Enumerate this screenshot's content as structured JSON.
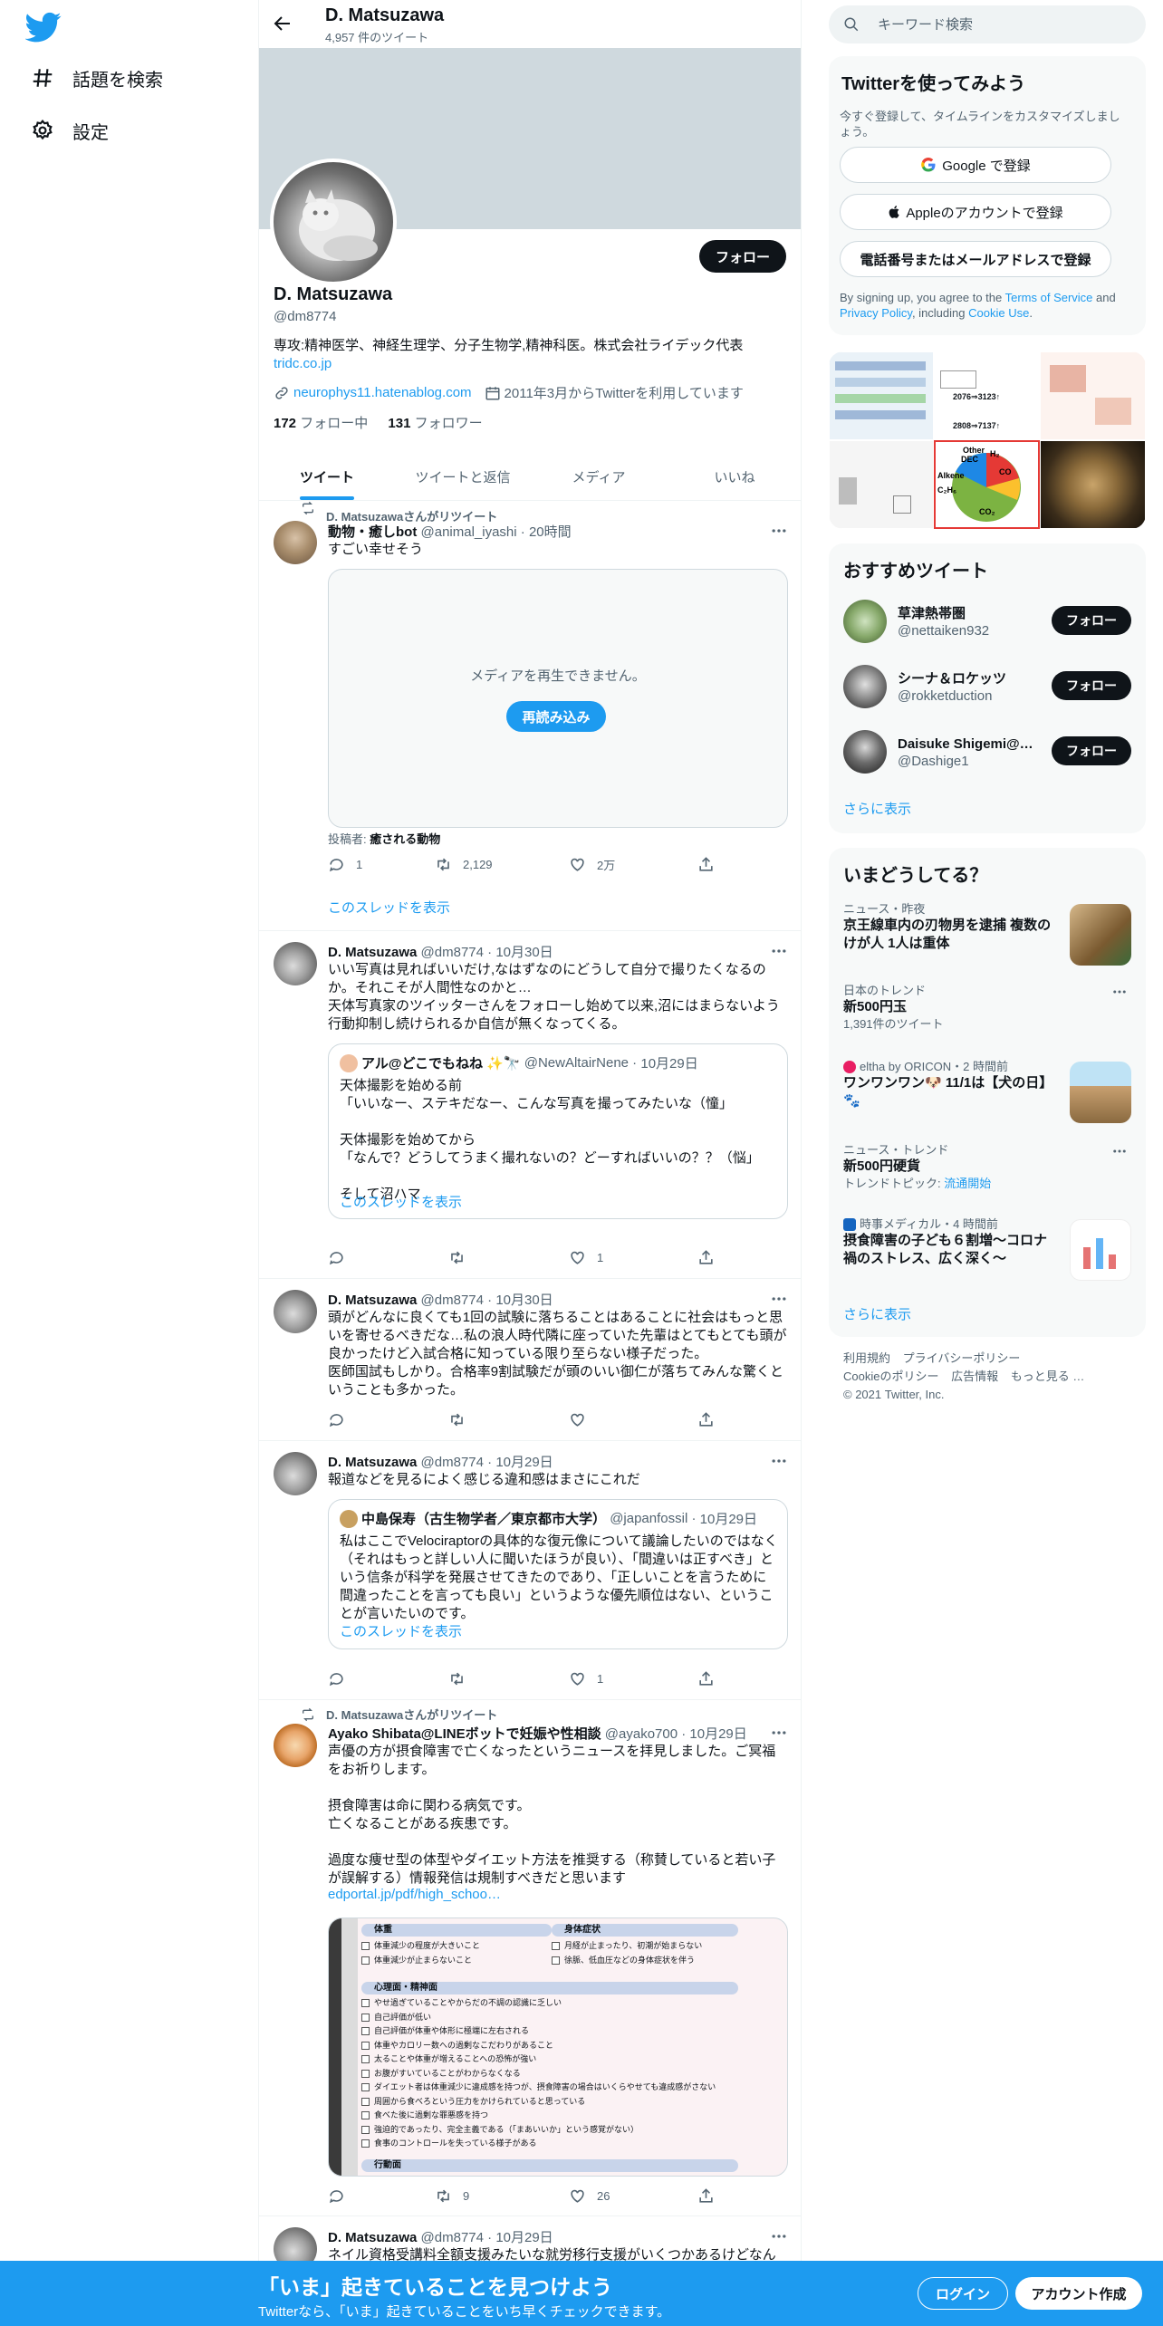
{
  "nav": {
    "explore_label": "話題を検索",
    "settings_label": "設定"
  },
  "header": {
    "name": "D. Matsuzawa",
    "tweet_count": "4,957 件のツイート"
  },
  "profile": {
    "follow_label": "フォロー",
    "name": "D. Matsuzawa",
    "handle": "@dm8774",
    "bio": "専攻:精神医学、神経生理学、分子生物学,精神科医。株式会社ライデック代表",
    "bio_link": "tridc.co.jp",
    "website": "neurophys11.hatenablog.com",
    "joined": "2011年3月からTwitterを利用しています",
    "following_count": "172",
    "following_label": "フォロー中",
    "followers_count": "131",
    "followers_label": "フォロワー"
  },
  "tabs": [
    "ツイート",
    "ツイートと返信",
    "メディア",
    "いいね"
  ],
  "tweets": [
    {
      "retweet_by": "D. Matsuzawaさんがリツイート",
      "name": "動物・癒しbot",
      "handle": "@animal_iyashi",
      "time": "20時間",
      "text": "すごい幸せそう",
      "media_message": "メディアを再生できません。",
      "media_reload": "再読み込み",
      "posted_by_label": "投稿者:",
      "posted_by": "癒される動物",
      "replies": "1",
      "retweets": "2,129",
      "likes": "2万",
      "thread_link": "このスレッドを表示"
    },
    {
      "name": "D. Matsuzawa",
      "handle": "@dm8774",
      "time": "10月30日",
      "text": "いい写真は見ればいいだけ,なはずなのにどうして自分で撮りたくなるのか。それこそが人間性なのかと…\n天体写真家のツイッターさんをフォローし始めて以来,沼にはまらないよう行動抑制し続けられるか自信が無くなってくる。",
      "quote_name": "アル@どこでもねね",
      "quote_handle": "@NewAltairNene",
      "quote_time": "10月29日",
      "quote_text": "天体撮影を始める前\n「いいなー、ステキだなー、こんな写真を撮ってみたいな（憧」\n\n天体撮影を始めてから\n「なんで？どうしてうまく撮れないの？どーすればいいの？？（悩」\n\nそして沼ハマ",
      "quote_thread": "このスレッドを表示",
      "replies": "",
      "retweets": "",
      "likes": "1"
    },
    {
      "name": "D. Matsuzawa",
      "handle": "@dm8774",
      "time": "10月30日",
      "text": "頭がどんなに良くても1回の試験に落ちることはあることに社会はもっと思いを寄せるべきだな…私の浪人時代隣に座っていた先輩はとてもとても頭が良かったけど入試合格に知っている限り至らない様子だった。\n医師国試もしかり。合格率9割試験だが頭のいい御仁が落ちてみんな驚くということも多かった。",
      "replies": "",
      "retweets": "",
      "likes": ""
    },
    {
      "name": "D. Matsuzawa",
      "handle": "@dm8774",
      "time": "10月29日",
      "text": "報道などを見るによく感じる違和感はまさにこれだ",
      "quote_name": "中島保寿（古生物学者／東京都市大学）",
      "quote_handle": "@japanfossil",
      "quote_time": "10月29日",
      "quote_text": "私はここでVelociraptorの具体的な復元像について議論したいのではなく（それはもっと詳しい人に聞いたほうが良い）、「間違いは正すべき」という信条が科学を発展させてきたのであり、「正しいことを言うために間違ったことを言っても良い」というような優先順位はない、ということが言いたいのです。",
      "quote_thread": "このスレッドを表示",
      "replies": "",
      "retweets": "",
      "likes": "1"
    },
    {
      "retweet_by": "D. Matsuzawaさんがリツイート",
      "name": "Ayako Shibata@LINEボットで妊娠や性相談",
      "handle": "@ayako700",
      "time": "10月29日",
      "text": "声優の方が摂食障害で亡くなったというニュースを拝見しました。ご冥福をお祈りします。\n\n摂食障害は命に関わる病気です。\n亡くなることがある疾患です。\n\n過度な痩せ型の体型やダイエット方法を推奨する（称賛していると若い子が誤解する）情報発信は規制すべきだと思います",
      "link": "edportal.jp/pdf/high_schoo…",
      "doc": {
        "sec1": "体重",
        "sec1_items": [
          "体重減少の程度が大きいこと",
          "体重減少が止まらないこと"
        ],
        "sec2": "身体症状",
        "sec2_items": [
          "月経が止まったり、初潮が始まらない",
          "徐脈、低血圧などの身体症状を伴う"
        ],
        "sec3": "心理面・精神面",
        "sec3_items": [
          "やせ過ぎていることやからだの不調の認識に乏しい",
          "自己評価が低い",
          "自己評価が体重や体形に極端に左右される",
          "体重やカロリー数への過剰なこだわりがあること",
          "太ることや体重が増えることへの恐怖が強い",
          "お腹がすいていることがわからなくなる",
          "ダイエット者は体重減少に違成感を持つが、摂食障害の場合はいくらやせても違成感がさない",
          "周囲から食べろという圧力をかけられていると思っている",
          "食べた後に過剰な罪悪感を持つ",
          "強迫的であったり、完全主義である（「まあいいか」という感覚がない）",
          "食事のコントロールを失っている様子がある"
        ],
        "sec4": "行動面"
      },
      "replies": "",
      "retweets": "9",
      "likes": "26"
    },
    {
      "name": "D. Matsuzawa",
      "handle": "@dm8774",
      "time": "10月29日",
      "text": "ネイル資格受講料全額支援みたいな就労移行支援がいくつかあるけどなん"
    }
  ],
  "right": {
    "search_placeholder": "キーワード検索",
    "signup": {
      "title": "Twitterを使ってみよう",
      "subtitle": "今すぐ登録して、タイムラインをカスタマイズしましょう。",
      "google": "Google で登録",
      "apple": "Appleのアカウントで登録",
      "phone": "電話番号またはメールアドレスで登録",
      "terms_pre": "By signing up, you agree to the ",
      "terms_link": "Terms of Service",
      "terms_and": " and ",
      "privacy_link": "Privacy Policy",
      "terms_including": ", including ",
      "cookie_link": "Cookie Use",
      "terms_end": "."
    },
    "media_grid_texts": {
      "m2_a": "2076⇒3123↑",
      "m2_b": "2808⇒7137↑",
      "pie_labels": [
        "Other",
        "DEC",
        "H₂",
        "Alkene",
        "C₂H₆",
        "CO",
        "CO₂"
      ]
    },
    "who": {
      "title": "おすすめツイート",
      "users": [
        {
          "name": "草津熱帯圏",
          "handle": "@nettaiken932",
          "button": "フォロー"
        },
        {
          "name": "シーナ＆ロケッツ",
          "handle": "@rokketduction",
          "button": "フォロー"
        },
        {
          "name": "Daisuke Shigemi@産…",
          "handle": "@Dashige1",
          "button": "フォロー"
        }
      ],
      "more": "さらに表示"
    },
    "trends": {
      "title": "いまどうしてる？",
      "items": [
        {
          "meta": "ニュース・昨夜",
          "title": "京王線車内の刃物男を逮捕 複数のけが人 1人は重体",
          "sub": ""
        },
        {
          "meta": "日本のトレンド",
          "title": "新500円玉",
          "sub": "1,391件のツイート"
        },
        {
          "meta": "eltha by ORICON・2 時間前",
          "title": "ワンワンワン🐶 11/1は【犬の日】🐾",
          "sub": ""
        },
        {
          "meta": "ニュース・トレンド",
          "title": "新500円硬貨",
          "sub": "トレンドトピック: ",
          "sub_link": "流通開始"
        },
        {
          "meta": "時事メディカル・4 時間前",
          "title": "摂食障害の子ども６割増～コロナ禍のストレス、広く深く～",
          "sub": ""
        }
      ],
      "more": "さらに表示"
    },
    "footer": [
      "利用規約",
      "プライバシーポリシー",
      "Cookieのポリシー",
      "広告情報",
      "もっと見る …",
      "© 2021 Twitter, Inc."
    ]
  },
  "bottom": {
    "title": "「いま」起きていることを見つけよう",
    "subtitle": "Twitterなら、「いま」起きていることをいち早くチェックできます。",
    "login": "ログイン",
    "signup": "アカウント作成"
  },
  "colors": {
    "brand": "#1d9bf0",
    "text": "#0f1419",
    "muted": "#536471",
    "border": "#eff3f4",
    "banner": "#cfd9de"
  }
}
